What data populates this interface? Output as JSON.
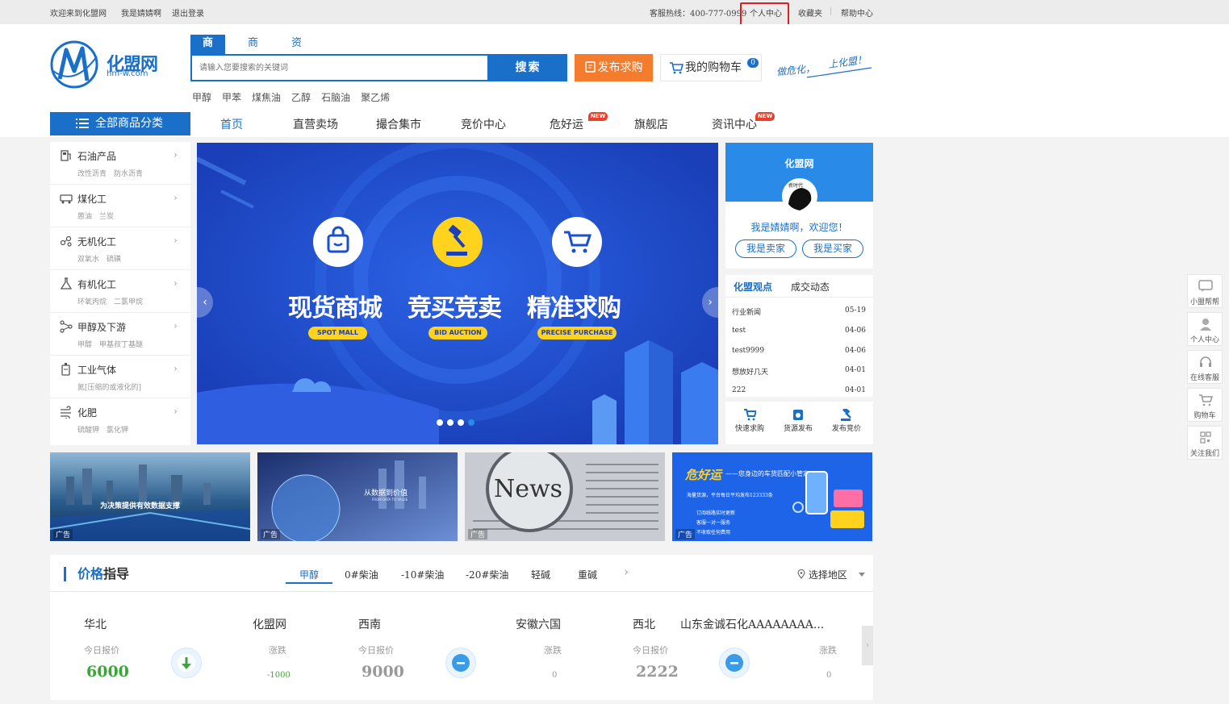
{
  "topbar": {
    "welcome": "欢迎来到化盟网",
    "username": "我是婧婧啊",
    "logout": "退出登录",
    "hotline": "客服热线：400-777-0999",
    "personal_center": "个人中心",
    "favorites": "收藏夹",
    "sep": "|",
    "help": "帮助中心"
  },
  "logo": {
    "cn": "化盟网",
    "url": "hm-w.com"
  },
  "search": {
    "tabs": [
      "商品",
      "商家",
      "资讯"
    ],
    "placeholder": "请输入您要搜索的关键词",
    "button": "搜索",
    "hot": [
      "甲醇",
      "甲苯",
      "煤焦油",
      "乙醇",
      "石脑油",
      "聚乙烯"
    ]
  },
  "publish_button": "发布求购",
  "cart": {
    "label": "我的购物车",
    "count": "0"
  },
  "slogan": {
    "left": "做危化，",
    "right": "上化盟！"
  },
  "all_categories": "全部商品分类",
  "nav": [
    "首页",
    "直营卖场",
    "撮合集市",
    "竞价中心",
    "危好运",
    "旗舰店",
    "资讯中心"
  ],
  "new_badge": "NEW",
  "categories": [
    {
      "name": "石油产品",
      "sub": "改性沥青　防水沥青"
    },
    {
      "name": "煤化工",
      "sub": "蒽油　兰炭"
    },
    {
      "name": "无机化工",
      "sub": "双氧水　硫磺"
    },
    {
      "name": "有机化工",
      "sub": "环氧丙烷　二氯甲烷"
    },
    {
      "name": "甲醇及下游",
      "sub": "甲醇　甲基叔丁基醚"
    },
    {
      "name": "工业气体",
      "sub": "氮[压缩的或液化的]"
    },
    {
      "name": "化肥",
      "sub": "硫酸钾　氯化钾"
    }
  ],
  "chevron": "›",
  "banner": {
    "items": [
      {
        "title": "现货商城",
        "tag": "SPOT MALL"
      },
      {
        "title": "竞买竞卖",
        "tag": "BID AUCTION"
      },
      {
        "title": "精准求购",
        "tag": "PRECISE PURCHASE"
      }
    ],
    "prev": "‹",
    "next": "›",
    "slide_count": 4,
    "active_slide": 4
  },
  "user_card": {
    "site": "化盟网",
    "avatar_text": "新时代 ",
    "welcome": "我是婧婧啊，欢迎您！",
    "seller": "我是卖家",
    "buyer": "我是买家"
  },
  "news": {
    "tabs": [
      "化盟观点",
      "成交动态"
    ],
    "items": [
      {
        "title": "行业新闻",
        "date": "05-19"
      },
      {
        "title": "test",
        "date": "04-06"
      },
      {
        "title": "test9999",
        "date": "04-06"
      },
      {
        "title": "想放好几天",
        "date": "04-01"
      },
      {
        "title": "222",
        "date": "04-01"
      }
    ]
  },
  "quick_actions": [
    "快速求购",
    "货源发布",
    "发布竞价"
  ],
  "ads": {
    "label": "广告",
    "items": [
      {
        "text": "为决策提供有效数据支撑"
      },
      {
        "text": "从数据到价值",
        "sub": "FROM DATA TO VALUE"
      },
      {
        "text": "News"
      },
      {
        "brand": "危好运",
        "tagline": "——您身边的车货匹配小管家",
        "line1": "海量货源，平台每日平均发布123333条",
        "bullets": [
          "订阅线路实时更新",
          "客服一对一服务",
          "不收取任何费用"
        ]
      }
    ]
  },
  "price_guide": {
    "title_a": "价格",
    "title_b": "指导",
    "tabs": [
      "甲醇",
      "0#柴油",
      "-10#柴油",
      "-20#柴油",
      "轻碱",
      "重碱"
    ],
    "next": "›",
    "region": "选择地区",
    "today_label": "今日报价",
    "change_label": "涨跌",
    "cards": [
      {
        "region": "华北",
        "company": "化盟网",
        "price": "6000",
        "change": "-1000",
        "trend": "down"
      },
      {
        "region": "西南",
        "company": "安徽六国",
        "price": "9000",
        "change": "0",
        "trend": "flat"
      },
      {
        "region": "西北",
        "company": "山东金诚石化AAAAAAAA...",
        "price": "2222",
        "change": "0",
        "trend": "flat"
      }
    ]
  },
  "sidebar": [
    "小盟帮帮",
    "个人中心",
    "在线客服",
    "购物车",
    "关注我们"
  ],
  "colors": {
    "primary": "#1a6fc9",
    "orange": "#f47c2c",
    "green": "#3aa63a",
    "highlight": "#e02020"
  }
}
